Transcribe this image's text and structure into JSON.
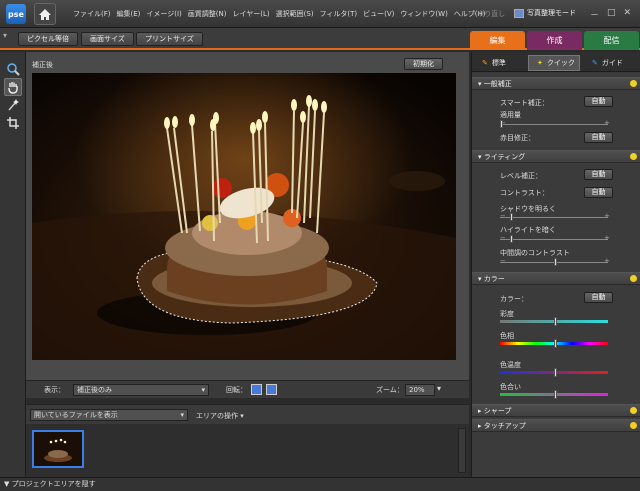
{
  "app": {
    "logo": "pse",
    "home_icon": "home-icon"
  },
  "menu": [
    "ファイル(F)",
    "編集(E)",
    "イメージ(I)",
    "画質調整(N)",
    "レイヤー(L)",
    "選択範囲(S)",
    "フィルタ(T)",
    "ビュー(V)",
    "ウィンドウ(W)",
    "ヘルプ(H)"
  ],
  "toolbar": {
    "undo_label": "やり直し",
    "mode_label": "写真整理モード"
  },
  "window_controls": {
    "minimize": "－",
    "restore": "□",
    "close": "✕"
  },
  "options": {
    "actual_pixels": "ピクセル等倍",
    "fit_screen": "画面サイズ",
    "print_size": "プリントサイズ"
  },
  "main_tabs": {
    "edit": "編集",
    "create": "作成",
    "share": "配信",
    "colors": {
      "edit": "#e8701a",
      "create": "#8a2a6a",
      "share": "#2a8a4a"
    }
  },
  "canvas": {
    "caption": "補正後",
    "reset_label": "初期化"
  },
  "view_bar": {
    "view_label": "表示：",
    "view_value": "補正後のみ",
    "rotate_label": "回転：",
    "zoom_label": "ズーム：",
    "zoom_value": "20%"
  },
  "bin": {
    "files_dropdown": "開いているファイルを表示",
    "area_label": "エリアの操作"
  },
  "status": {
    "hide_project": "プロジェクトエリアを隠す"
  },
  "panel": {
    "tabs": {
      "standard": "標準",
      "quick": "クイック",
      "guide": "ガイド"
    },
    "general": {
      "title": "一般補正",
      "smart_fix": "スマート補正：",
      "auto": "自動",
      "amount": "適用量",
      "red_eye": "赤目修正："
    },
    "lighting": {
      "title": "ライティング",
      "levels": "レベル補正：",
      "contrast": "コントラスト：",
      "shadows": "シャドウを明るく",
      "highlights": "ハイライトを暗く",
      "midtone": "中間調のコントラスト"
    },
    "color": {
      "title": "カラー",
      "color_label": "カラー：",
      "saturation": "彩度",
      "hue": "色相",
      "temperature": "色温度",
      "tint": "色合い"
    },
    "sharpen": {
      "title": "シャープ"
    },
    "touchup": {
      "title": "タッチアップ"
    }
  }
}
